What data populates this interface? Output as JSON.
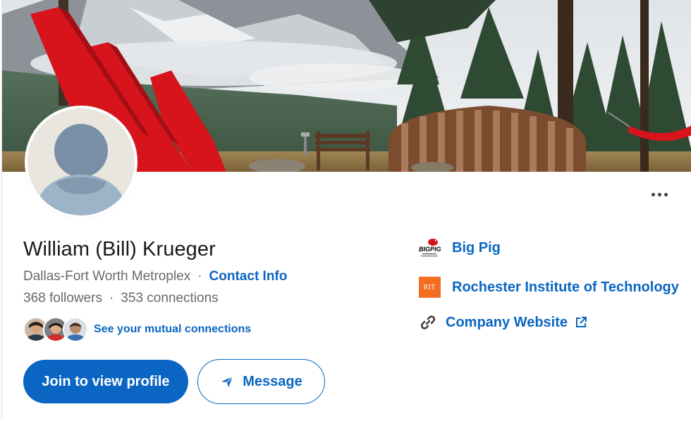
{
  "profile": {
    "name": "William (Bill) Krueger",
    "location": "Dallas-Fort Worth Metroplex",
    "separator": "·",
    "contact_info": "Contact Info",
    "followers": "368 followers",
    "connections": "353 connections",
    "mutual_connections": "See your mutual connections"
  },
  "actions": {
    "join_label": "Join to view profile",
    "message_label": "Message"
  },
  "sidebar": {
    "company": {
      "name": "Big Pig",
      "logo_text": "BIGPIG"
    },
    "school": {
      "name": "Rochester Institute of Technology",
      "logo_text": "RIT"
    },
    "website": {
      "label": "Company Website"
    }
  },
  "icons": {
    "more": "more-horizontal-icon",
    "message": "send-icon",
    "link": "link-icon",
    "external": "external-link-icon"
  },
  "colors": {
    "brand": "#0a66c2",
    "rit_orange": "#f36e21",
    "chair_red": "#d7141c"
  }
}
